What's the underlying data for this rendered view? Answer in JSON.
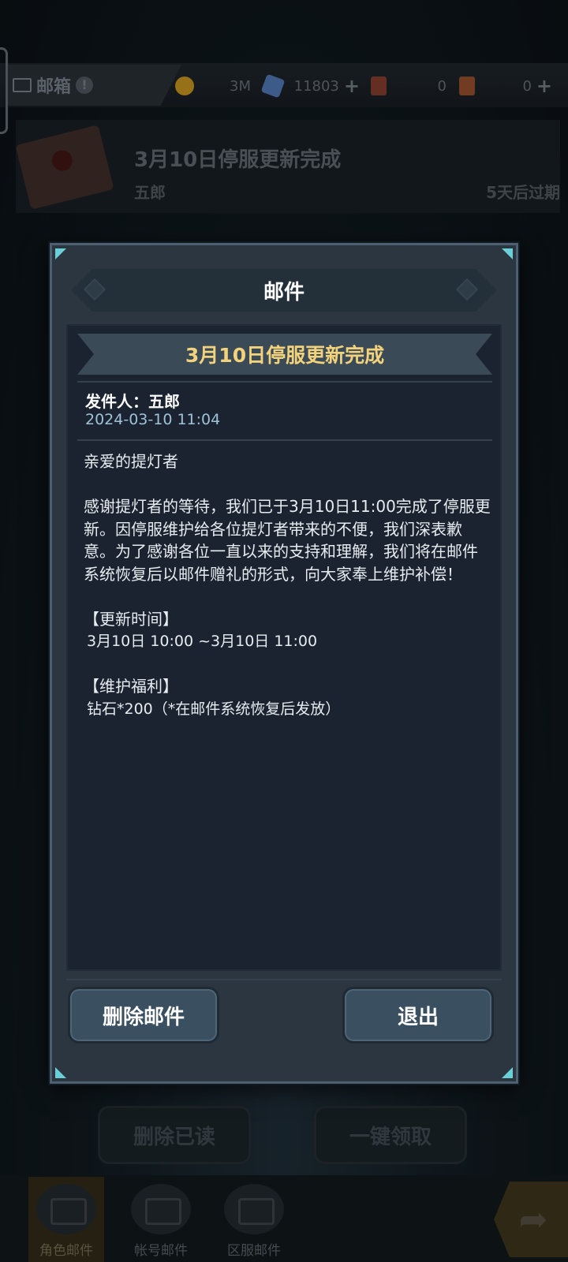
{
  "header": {
    "mailbox_label": "邮箱",
    "resources": [
      {
        "name": "coin",
        "value": "3M",
        "color": "#b98a1e"
      },
      {
        "name": "crystal",
        "value": "11803",
        "color": "#4a6fa8",
        "has_plus": true
      },
      {
        "name": "ticket_a",
        "value": "0",
        "color": "#7a3a2a"
      },
      {
        "name": "ticket_b",
        "value": "0",
        "color": "#8a4a2a",
        "has_plus": true
      }
    ]
  },
  "mail_list": [
    {
      "title": "3月10日停服更新完成",
      "sender": "五郎",
      "expire": "5天后过期"
    }
  ],
  "background_buttons": {
    "delete_read": "删除已读",
    "claim_all": "一键领取"
  },
  "bottom_nav": [
    {
      "label": "角色邮件",
      "active": true,
      "icon": "envelope-icon"
    },
    {
      "label": "帐号邮件",
      "active": false,
      "icon": "account-mail-icon"
    },
    {
      "label": "区服邮件",
      "active": false,
      "icon": "server-mail-icon"
    }
  ],
  "share_icon": "share-arrow-icon",
  "modal": {
    "title": "邮件",
    "subject": "3月10日停服更新完成",
    "sender_label": "发件人：",
    "sender_name": "五郎",
    "date": "2024-03-10 11:04",
    "body": {
      "greeting": "亲爱的提灯者",
      "paragraph": "感谢提灯者的等待，我们已于3月10日11:00完成了停服更新。因停服维护给各位提灯者带来的不便，我们深表歉意。为了感谢各位一直以来的支持和理解，我们将在邮件系统恢复后以邮件赠礼的形式，向大家奉上维护补偿！",
      "update_time_heading": "【更新时间】",
      "update_time_value": "3月10日 10:00 ~3月10日 11:00",
      "benefit_heading": "【维护福利】",
      "benefit_value": "钻石*200（*在邮件系统恢复后发放）"
    },
    "delete_button": "删除邮件",
    "exit_button": "退出"
  },
  "colors": {
    "subject_gold": "#f2d27a",
    "date_blue": "#9fc2d8",
    "corner_cyan": "#6ad0d8",
    "button_fill": "#3a4f60"
  }
}
